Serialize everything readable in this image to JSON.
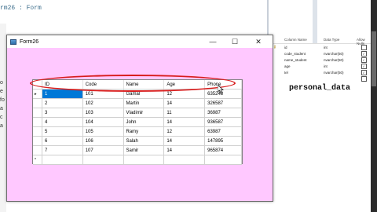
{
  "ide": {
    "editor_title": "rm26 : Form",
    "gutter_lines": [
      "o",
      "e",
      "fo",
      "a",
      "c",
      "a"
    ]
  },
  "designer": {
    "headers": [
      "Column Name",
      "Data Type",
      "Allow Nulls"
    ],
    "rows": [
      {
        "name": "id",
        "type": "int",
        "nulls": false,
        "key": true
      },
      {
        "name": "code_student",
        "type": "nvarchar(50)",
        "nulls": true,
        "key": false
      },
      {
        "name": "name_student",
        "type": "nvarchar(50)",
        "nulls": true,
        "key": false
      },
      {
        "name": "age",
        "type": "int",
        "nulls": true,
        "key": false
      },
      {
        "name": "tel",
        "type": "nvarchar(50)",
        "nulls": true,
        "key": false
      },
      {
        "name": "",
        "type": "",
        "nulls": false,
        "key": false
      }
    ],
    "table_name": "personal_data"
  },
  "window": {
    "title": "Form26",
    "minimize": "—",
    "maximize": "☐",
    "close": "✕"
  },
  "grid": {
    "columns": [
      "ID",
      "Code",
      "Name",
      "Age",
      "Phone"
    ],
    "rows": [
      [
        "1",
        "101",
        "Gamal",
        "12",
        "635248"
      ],
      [
        "2",
        "102",
        "Martin",
        "14",
        "326587"
      ],
      [
        "3",
        "103",
        "Vladimir",
        "11",
        "36987"
      ],
      [
        "4",
        "104",
        "John",
        "14",
        "936587"
      ],
      [
        "5",
        "105",
        "Ramy",
        "12",
        "63987"
      ],
      [
        "6",
        "106",
        "Salah",
        "14",
        "147895"
      ],
      [
        "7",
        "107",
        "Samir",
        "14",
        "965874"
      ]
    ],
    "current_row_marker": "▸",
    "new_row_marker": "*",
    "accent": "#0078d7"
  }
}
